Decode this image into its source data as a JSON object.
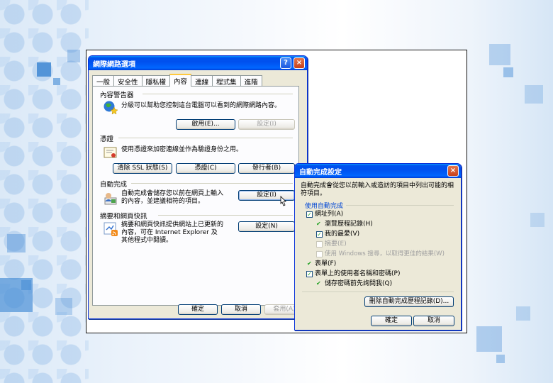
{
  "main_dialog": {
    "title": "網際網路選項",
    "help_btn": "?",
    "close_btn": "×",
    "tabs": [
      "一般",
      "安全性",
      "隱私權",
      "內容",
      "連線",
      "程式集",
      "進階"
    ],
    "content_advisor": {
      "heading": "內容警告器",
      "desc": "分級可以幫助您控制這台電腦可以看到的網際網路內容。",
      "enable_btn": "啟用(E)...",
      "settings_btn": "設定(I)"
    },
    "certificates": {
      "heading": "憑證",
      "desc": "使用憑證來加密連線並作為驗證身份之用。",
      "clear_ssl_btn": "清除 SSL 狀態(S)",
      "certs_btn": "憑證(C)",
      "publishers_btn": "發行者(B)"
    },
    "autocomplete": {
      "heading": "自動完成",
      "desc": "自動完成會儲存您以前在網頁上輸入的內容，並建議相符的項目。",
      "settings_btn": "設定(I)"
    },
    "feeds": {
      "heading": "摘要和網頁快訊",
      "desc": "摘要和網頁快訊提供網站上已更新的內容，可在 Internet Explorer 及其他程式中閱讀。",
      "settings_btn": "設定(N)"
    },
    "ok_btn": "確定",
    "cancel_btn": "取消",
    "apply_btn": "套用(A)"
  },
  "autocomplete_dialog": {
    "title": "自動完成設定",
    "close_btn": "×",
    "intro": "自動完成會從您以前輸入或造訪的項目中列出可能的相符項目。",
    "group_label": "使用自動完成",
    "options": [
      {
        "label": "網址列(A)",
        "checked": true,
        "indent": 0,
        "disabled": false
      },
      {
        "label": "瀏覽歷程記錄(H)",
        "checked": true,
        "indent": 1,
        "disabled": false
      },
      {
        "label": "我的最愛(V)",
        "checked": true,
        "indent": 1,
        "disabled": false
      },
      {
        "label": "摘要(E)",
        "checked": false,
        "indent": 1,
        "disabled": true
      },
      {
        "label": "使用 Windows 搜尋，以取得更佳的結果(W)",
        "checked": false,
        "indent": 1,
        "disabled": true
      },
      {
        "label": "表單(F)",
        "checked": true,
        "indent": 0,
        "disabled": false
      },
      {
        "label": "表單上的使用者名稱和密碼(P)",
        "checked": true,
        "indent": 0,
        "disabled": false
      },
      {
        "label": "儲存密碼前先詢問我(Q)",
        "checked": true,
        "indent": 1,
        "disabled": false
      }
    ],
    "delete_history_btn": "刪除自動完成歷程記錄(D)...",
    "ok_btn": "確定",
    "cancel_btn": "取消"
  }
}
